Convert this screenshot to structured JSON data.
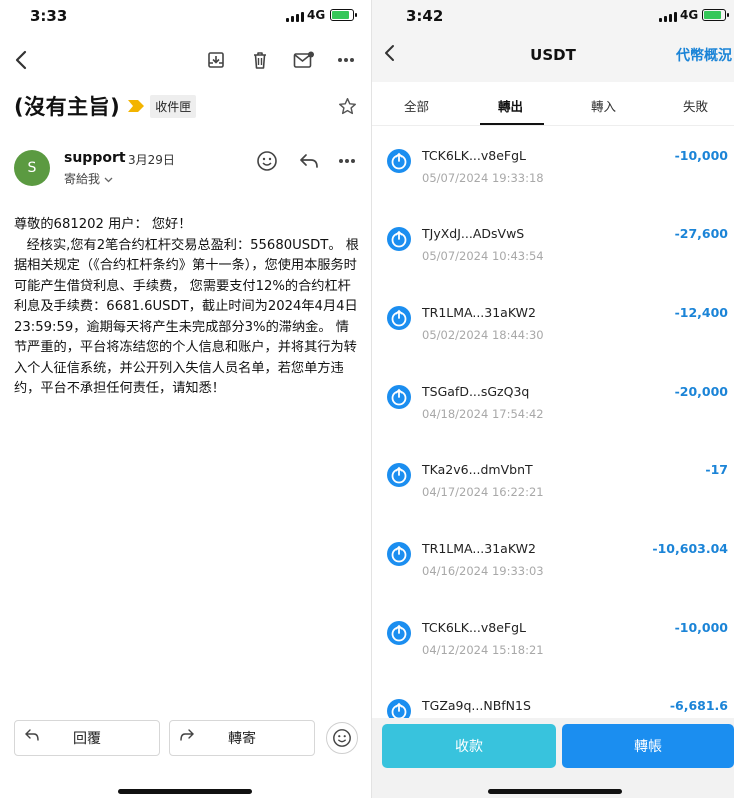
{
  "left": {
    "status": {
      "time": "3:33",
      "network": "4G"
    },
    "toolbar": {
      "back_icon": "chevron-left-icon",
      "archive_icon": "archive-icon",
      "delete_icon": "trash-icon",
      "mark_icon": "mail-unread-icon",
      "more_icon": "more-icon"
    },
    "subject": "(沒有主旨)",
    "folder": "收件匣",
    "sender": {
      "initial": "S",
      "name": "support",
      "date": "3月29日",
      "recipient": "寄給我"
    },
    "body": [
      "尊敬的681202 用户： 您好！",
      "   经核实,您有2笔合约杠杆交易总盈利：55680USDT。 根据相关规定（《合约杠杆条约》第十一条），您使用本服务时可能产生借贷利息、手续费， 您需要支付12%的合约杠杆利息及手续费：6681.6USDT，截止时间为2024年4月4日23:59:59，逾期每天将产生未完成部分3%的滞纳金。 情节严重的，平台将冻结您的个人信息和账户，并将其行为转入个人征信系统，并公开列入失信人员名单，若您单方违约，平台不承担任何责任，请知悉！"
    ],
    "buttons": {
      "reply": "回覆",
      "forward": "轉寄"
    }
  },
  "right": {
    "status": {
      "time": "3:42",
      "network": "4G"
    },
    "header": {
      "title": "USDT",
      "overview": "代幣概況"
    },
    "tabs": [
      "全部",
      "轉出",
      "轉入",
      "失敗"
    ],
    "active_tab": "轉出",
    "transactions": [
      {
        "address": "TCK6LK...v8eFgL",
        "time": "05/07/2024 19:33:18",
        "amount": "-10,000"
      },
      {
        "address": "TJyXdJ...ADsVwS",
        "time": "05/07/2024 10:43:54",
        "amount": "-27,600"
      },
      {
        "address": "TR1LMA...31aKW2",
        "time": "05/02/2024 18:44:30",
        "amount": "-12,400"
      },
      {
        "address": "TSGafD...sGzQ3q",
        "time": "04/18/2024 17:54:42",
        "amount": "-20,000"
      },
      {
        "address": "TKa2v6...dmVbnT",
        "time": "04/17/2024 16:22:21",
        "amount": "-17"
      },
      {
        "address": "TR1LMA...31aKW2",
        "time": "04/16/2024 19:33:03",
        "amount": "-10,603.04"
      },
      {
        "address": "TCK6LK...v8eFgL",
        "time": "04/12/2024 15:18:21",
        "amount": "-10,000"
      },
      {
        "address": "TGZa9q...NBfN1S",
        "time": "",
        "amount": "-6,681.6"
      }
    ],
    "buttons": {
      "receive": "收款",
      "send": "轉帳"
    },
    "colors": {
      "accent": "#1b84d7",
      "receive": "#38c3dd",
      "send": "#1b8ef0"
    }
  }
}
